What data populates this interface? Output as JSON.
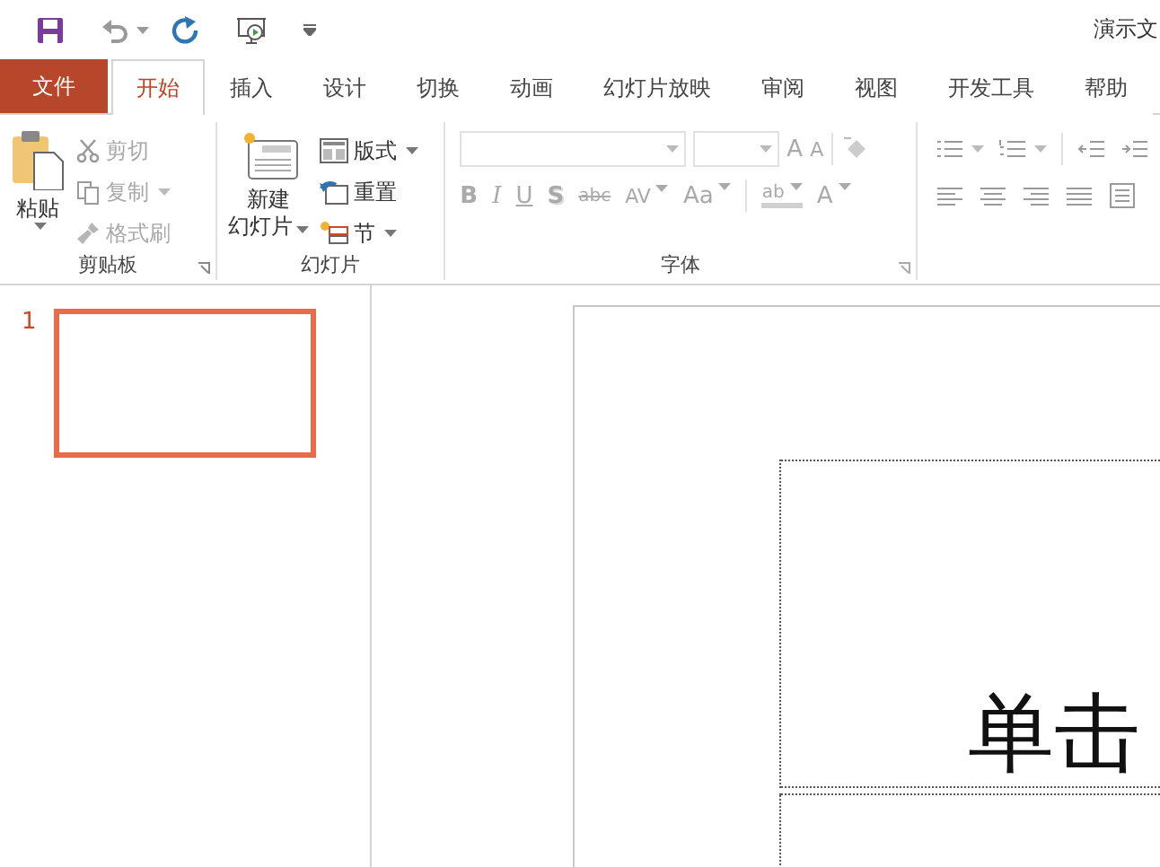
{
  "title_bar": {
    "title": "演示文"
  },
  "tabs": [
    {
      "label": "文件",
      "kind": "file",
      "selected": false
    },
    {
      "label": "开始",
      "kind": "tab",
      "selected": true
    },
    {
      "label": "插入",
      "kind": "tab",
      "selected": false
    },
    {
      "label": "设计",
      "kind": "tab",
      "selected": false
    },
    {
      "label": "切换",
      "kind": "tab",
      "selected": false
    },
    {
      "label": "动画",
      "kind": "tab",
      "selected": false
    },
    {
      "label": "幻灯片放映",
      "kind": "tab",
      "selected": false
    },
    {
      "label": "审阅",
      "kind": "tab",
      "selected": false
    },
    {
      "label": "视图",
      "kind": "tab",
      "selected": false
    },
    {
      "label": "开发工具",
      "kind": "tab",
      "selected": false
    },
    {
      "label": "帮助",
      "kind": "tab",
      "selected": false
    }
  ],
  "clipboard": {
    "label": "剪贴板",
    "paste": "粘贴",
    "items": [
      {
        "label": "剪切",
        "kind": "cut",
        "has_menu": false,
        "disabled": true
      },
      {
        "label": "复制",
        "kind": "copy",
        "has_menu": true,
        "disabled": true
      },
      {
        "label": "格式刷",
        "kind": "brush",
        "has_menu": false,
        "disabled": true
      }
    ]
  },
  "slides_group": {
    "label": "幻灯片",
    "new_slide": [
      "新建",
      "幻灯片"
    ],
    "items": [
      {
        "label": "版式",
        "kind": "layout",
        "has_menu": true
      },
      {
        "label": "重置",
        "kind": "reset",
        "has_menu": false
      },
      {
        "label": "节",
        "kind": "section",
        "has_menu": true
      }
    ]
  },
  "font_group": {
    "label": "字体",
    "disabled": true,
    "row1": [
      {
        "label": "A",
        "kind": "grow",
        "has_menu": false
      },
      {
        "label": "A",
        "kind": "shrink",
        "has_menu": false
      }
    ],
    "row2": [
      {
        "label": "B",
        "kind": "bold",
        "has_menu": false
      },
      {
        "label": "I",
        "kind": "italic",
        "has_menu": false
      },
      {
        "label": "U",
        "kind": "underline",
        "has_menu": false
      },
      {
        "label": "S",
        "kind": "shadow",
        "has_menu": false
      },
      {
        "label": "abc",
        "kind": "strike",
        "has_menu": false
      },
      {
        "label": "AV",
        "kind": "spacing",
        "has_menu": true
      },
      {
        "label": "Aa",
        "kind": "case",
        "has_menu": true
      },
      {
        "label": "ab",
        "kind": "highlight",
        "has_menu": true
      },
      {
        "label": "A",
        "kind": "color",
        "has_menu": true
      }
    ]
  },
  "thumbnails": [
    {
      "number": "1",
      "selected": true
    }
  ],
  "slide": {
    "title_placeholder": "单击"
  }
}
